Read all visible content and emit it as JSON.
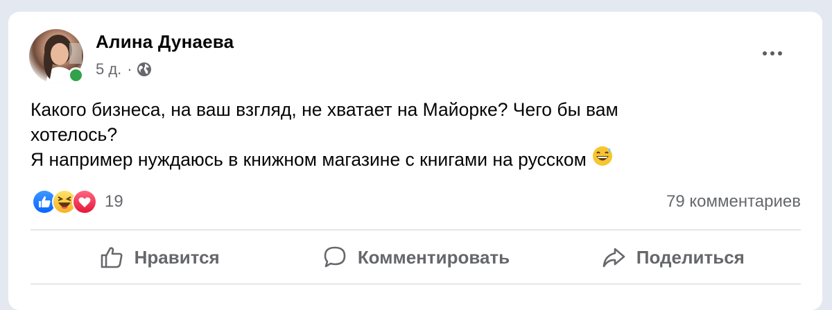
{
  "post": {
    "author": "Алина Дунаева",
    "time": "5 д.",
    "separator": "·",
    "audience_icon": "globe-icon",
    "text_lines": [
      "Какого бизнеса, на ваш взгляд, не хватает на Майорке? Чего бы вам",
      "хотелось?",
      "Я например нуждаюсь в книжном магазине с книгами на русском"
    ],
    "trailing_emoji": "grinning-sweat-emoji"
  },
  "reactions": {
    "types": [
      "like-reaction-icon",
      "haha-reaction-icon",
      "love-reaction-icon"
    ],
    "count": "19"
  },
  "comments": {
    "count_label": "79 комментариев"
  },
  "actions": {
    "like_label": "Нравится",
    "comment_label": "Комментировать",
    "share_label": "Поделиться"
  },
  "colors": {
    "page_bg": "#e4e9f1",
    "card_bg": "#ffffff",
    "secondary_text": "#65676b",
    "online_status": "#31a24c",
    "like_blue": "#1877f2",
    "love_red": "#f33e58",
    "haha_yellow": "#f7b125"
  }
}
